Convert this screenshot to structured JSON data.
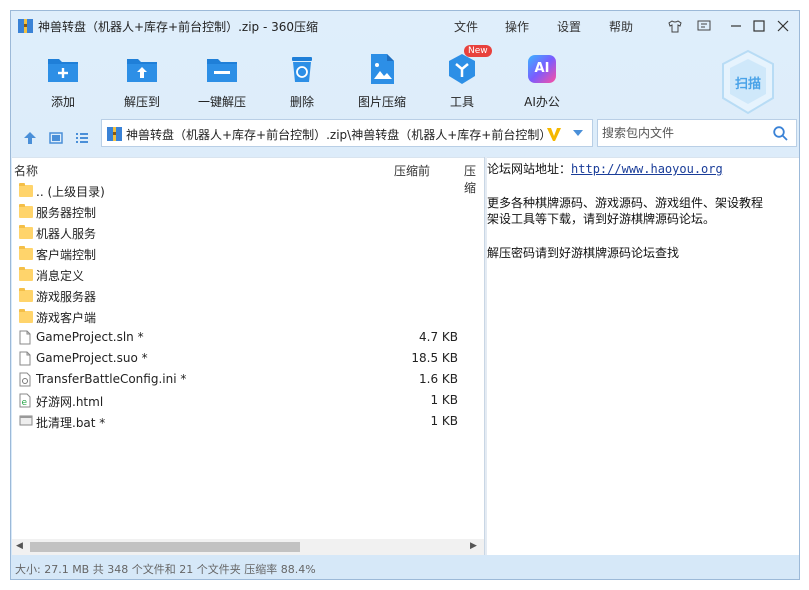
{
  "window": {
    "title": "神兽转盘（机器人+库存+前台控制）.zip - 360压缩",
    "menu": [
      "文件",
      "操作",
      "设置",
      "帮助"
    ]
  },
  "toolbar": {
    "items": [
      {
        "label": "添加",
        "icon": "add-icon"
      },
      {
        "label": "解压到",
        "icon": "extract-to-icon"
      },
      {
        "label": "一键解压",
        "icon": "one-click-extract-icon"
      },
      {
        "label": "删除",
        "icon": "delete-icon"
      },
      {
        "label": "图片压缩",
        "icon": "image-compress-icon"
      },
      {
        "label": "工具",
        "icon": "tools-icon"
      },
      {
        "label": "AI办公",
        "icon": "ai-office-icon"
      }
    ],
    "new_badge": "New",
    "ai_text": "AI",
    "scan_label": "扫描"
  },
  "address": {
    "path": "神兽转盘（机器人+库存+前台控制）.zip\\神兽转盘（机器人+库存+前台控制）",
    "search_placeholder": "搜索包内文件"
  },
  "filelist": {
    "columns": {
      "name": "名称",
      "size_before": "压缩前",
      "size_after": "压缩"
    },
    "rows": [
      {
        "name": ".. (上级目录)",
        "type": "folder",
        "size": ""
      },
      {
        "name": "服务器控制",
        "type": "folder",
        "size": ""
      },
      {
        "name": "机器人服务",
        "type": "folder",
        "size": ""
      },
      {
        "name": "客户端控制",
        "type": "folder",
        "size": ""
      },
      {
        "name": "消息定义",
        "type": "folder",
        "size": ""
      },
      {
        "name": "游戏服务器",
        "type": "folder",
        "size": ""
      },
      {
        "name": "游戏客户端",
        "type": "folder",
        "size": ""
      },
      {
        "name": "GameProject.sln *",
        "type": "file",
        "size": "4.7 KB"
      },
      {
        "name": "GameProject.suo *",
        "type": "file",
        "size": "18.5 KB"
      },
      {
        "name": "TransferBattleConfig.ini *",
        "type": "ini",
        "size": "1.6 KB"
      },
      {
        "name": "好游网.html",
        "type": "html",
        "size": "1 KB"
      },
      {
        "name": "批清理.bat *",
        "type": "bat",
        "size": "1 KB"
      }
    ]
  },
  "comment": {
    "site_label": "论坛网站地址：",
    "site_url": "http://www.haoyou.org",
    "line2": "更多各种棋牌源码、游戏源码、游戏组件、架设教程",
    "line3": "架设工具等下载，请到好游棋牌源码论坛。",
    "line4": "解压密码请到好游棋牌源码论坛查找"
  },
  "status": {
    "text": "大小: 27.1 MB 共 348 个文件和 21 个文件夹 压缩率 88.4%"
  },
  "colors": {
    "accent": "#1f7fd8",
    "folder": "#ffd46b",
    "badge": "#e8413c"
  }
}
